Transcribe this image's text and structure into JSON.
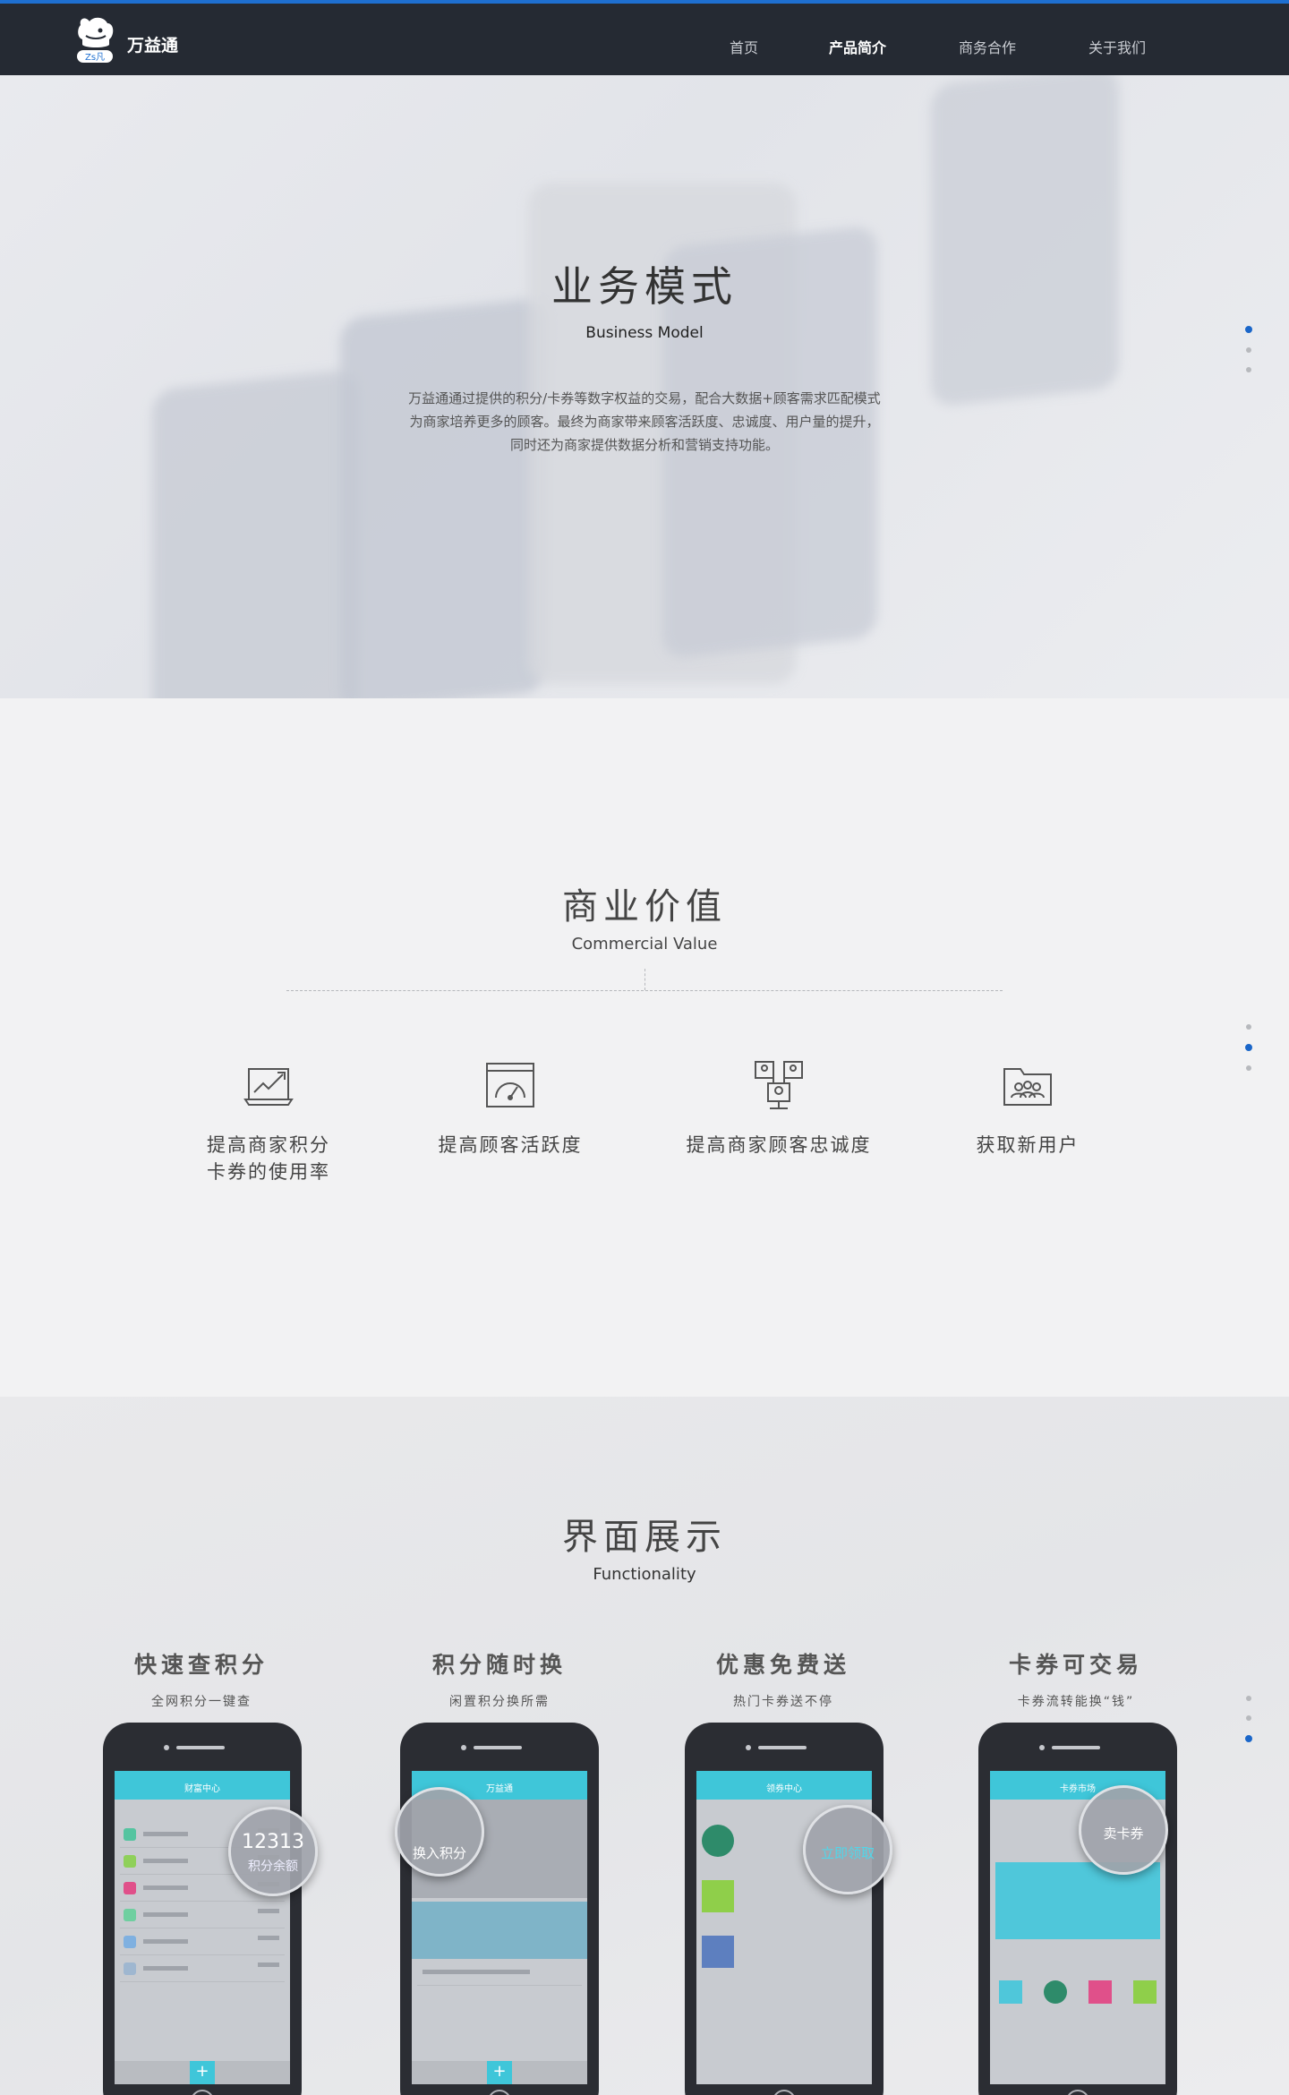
{
  "header": {
    "brand": "万益通",
    "logo_badge": "Zs凡",
    "nav": [
      "首页",
      "产品简介",
      "商务合作",
      "关于我们"
    ],
    "active_nav": "产品简介"
  },
  "section_business": {
    "title": "业务模式",
    "subtitle": "Business Model",
    "description_lines": [
      "万益通通过提供的积分/卡券等数字权益的交易，配合大数据+顾客需求匹配模式",
      "为商家培养更多的顾客。最终为商家带来顾客活跃度、忠诚度、用户量的提升，",
      "同时还为商家提供数据分析和营销支持功能。"
    ]
  },
  "section_value": {
    "title": "商业价值",
    "subtitle": "Commercial Value",
    "items": [
      {
        "icon": "chart-growth-icon",
        "label_lines": [
          "提高商家积分",
          "卡券的使用率"
        ]
      },
      {
        "icon": "speedometer-icon",
        "label_lines": [
          "提高顾客活跃度"
        ]
      },
      {
        "icon": "people-network-icon",
        "label_lines": [
          "提高商家顾客忠诚度"
        ]
      },
      {
        "icon": "user-group-folder-icon",
        "label_lines": [
          "获取新用户"
        ]
      }
    ]
  },
  "section_func": {
    "title": "界面展示",
    "subtitle": "Functionality",
    "features": [
      {
        "title": "快速查积分",
        "sub": "全网积分一键查",
        "screen_title": "财富中心",
        "bubble_main": "12313",
        "bubble_sub": "积分余额"
      },
      {
        "title": "积分随时换",
        "sub": "闲置积分换所需",
        "screen_title": "万益通",
        "bubble_main": "换入积分",
        "bubble_sub": ""
      },
      {
        "title": "优惠免费送",
        "sub": "热门卡券送不停",
        "screen_title": "领券中心",
        "bubble_main": "立即领取",
        "bubble_sub": ""
      },
      {
        "title": "卡券可交易",
        "sub": "卡券流转能换“钱”",
        "screen_title": "卡券市场",
        "bubble_main": "卖卡券",
        "bubble_sub": ""
      }
    ]
  },
  "colors": {
    "accent": "#1e6fd0",
    "header_bg": "#252a33",
    "app_cyan": "#3fc6d9"
  }
}
